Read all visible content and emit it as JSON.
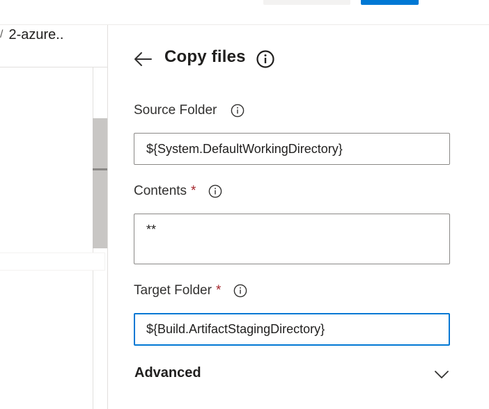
{
  "breadcrumb": {
    "separator": "/",
    "current": "2-azure.."
  },
  "panel": {
    "title": "Copy files",
    "fields": {
      "source_folder": {
        "label": "Source Folder",
        "value": "${System.DefaultWorkingDirectory}"
      },
      "contents": {
        "label": "Contents",
        "required_mark": "*",
        "value": "**"
      },
      "target_folder": {
        "label": "Target Folder",
        "required_mark": "*",
        "value": "${Build.ArtifactStagingDirectory}"
      }
    },
    "advanced": {
      "label": "Advanced"
    }
  },
  "colors": {
    "accent": "#0078d4",
    "required": "#a4262c",
    "border": "#8a8886"
  },
  "icons": {
    "back": "arrow-left-icon",
    "info": "info-icon",
    "expand": "chevron-down-icon"
  }
}
